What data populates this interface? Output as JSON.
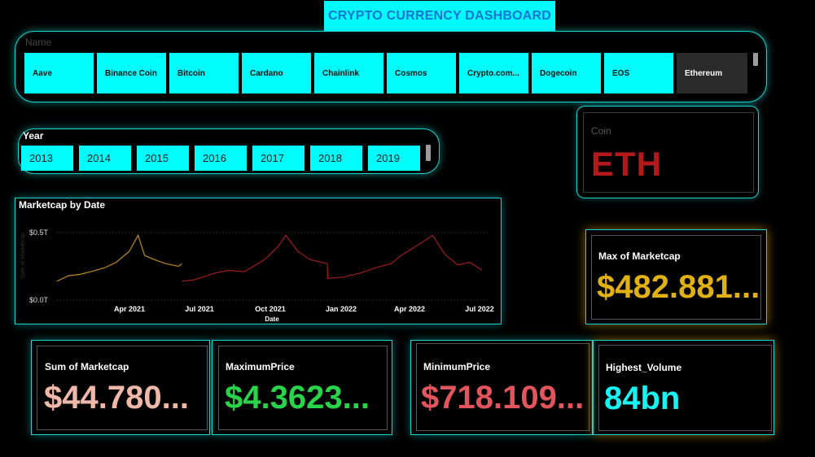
{
  "title": "CRYPTO CURRENCY DASHBOARD",
  "name_slicer": {
    "header": "Name",
    "items": [
      {
        "label": "Aave",
        "selected": false
      },
      {
        "label": "Binance Coin",
        "selected": false
      },
      {
        "label": "Bitcoin",
        "selected": false
      },
      {
        "label": "Cardano",
        "selected": false
      },
      {
        "label": "Chainlink",
        "selected": false
      },
      {
        "label": "Cosmos",
        "selected": false
      },
      {
        "label": "Crypto.com...",
        "selected": false
      },
      {
        "label": "Dogecoin",
        "selected": false
      },
      {
        "label": "EOS",
        "selected": false
      },
      {
        "label": "Ethereum",
        "selected": true
      }
    ]
  },
  "year_slicer": {
    "header": "Year",
    "items": [
      "2013",
      "2014",
      "2015",
      "2016",
      "2017",
      "2018",
      "2019"
    ]
  },
  "coin_card": {
    "label": "Coin",
    "value": "ETH"
  },
  "chart": {
    "title": "Marketcap by Date",
    "ylabel": "Sum of Marketcap",
    "xlabel": "Date",
    "yticks": [
      "$0.5T",
      "$0.0T"
    ],
    "xticks": [
      "Apr 2021",
      "Jul 2021",
      "Oct 2021",
      "Jan 2022",
      "Apr 2022",
      "Jul 2022"
    ]
  },
  "chart_data": {
    "type": "line",
    "title": "Marketcap by Date",
    "xlabel": "Date",
    "ylabel": "Sum of Marketcap",
    "ylim": [
      0,
      0.5
    ],
    "y_unit": "T",
    "grid": true,
    "series": [
      {
        "color": "#b88a1c",
        "x": [
          "2021-02-01",
          "2021-02-15",
          "2021-03-01",
          "2021-03-15",
          "2021-04-01",
          "2021-04-15",
          "2021-05-01",
          "2021-05-12",
          "2021-05-20",
          "2021-06-01",
          "2021-06-15",
          "2021-07-01",
          "2021-07-05"
        ],
        "values": [
          0.14,
          0.18,
          0.19,
          0.21,
          0.24,
          0.28,
          0.36,
          0.48,
          0.33,
          0.3,
          0.27,
          0.25,
          0.27
        ]
      },
      {
        "color": "#a01c1c",
        "x": [
          "2021-07-05",
          "2021-07-20",
          "2021-08-15",
          "2021-09-01",
          "2021-09-20",
          "2021-10-01",
          "2021-10-15",
          "2021-11-01",
          "2021-11-10",
          "2021-11-25",
          "2021-12-10",
          "2021-12-31",
          "2022-01-01",
          "2022-01-20",
          "2022-02-10",
          "2022-03-01",
          "2022-03-20",
          "2022-04-01",
          "2022-04-20",
          "2022-05-10",
          "2022-05-25",
          "2022-06-10",
          "2022-06-25",
          "2022-07-10"
        ],
        "values": [
          0.14,
          0.15,
          0.2,
          0.22,
          0.21,
          0.25,
          0.3,
          0.4,
          0.48,
          0.36,
          0.3,
          0.27,
          0.16,
          0.17,
          0.2,
          0.24,
          0.27,
          0.33,
          0.4,
          0.48,
          0.34,
          0.26,
          0.28,
          0.22
        ]
      }
    ]
  },
  "kpis": {
    "max_marketcap": {
      "label": "Max of Marketcap",
      "value": "$482.881...",
      "color": "#e1b012"
    },
    "sum_marketcap": {
      "label": "Sum of Marketcap",
      "value": "$44.780...",
      "color": "#f0b8a8"
    },
    "maximum_price": {
      "label": "MaximumPrice",
      "value": "$4.3623...",
      "color": "#2ad44a"
    },
    "minimum_price": {
      "label": "MinimumPrice",
      "value": "$718.109...",
      "color": "#e2555c"
    },
    "highest_volume": {
      "label": "Highest_Volume",
      "value": "84bn",
      "color": "#19f2f2"
    }
  }
}
